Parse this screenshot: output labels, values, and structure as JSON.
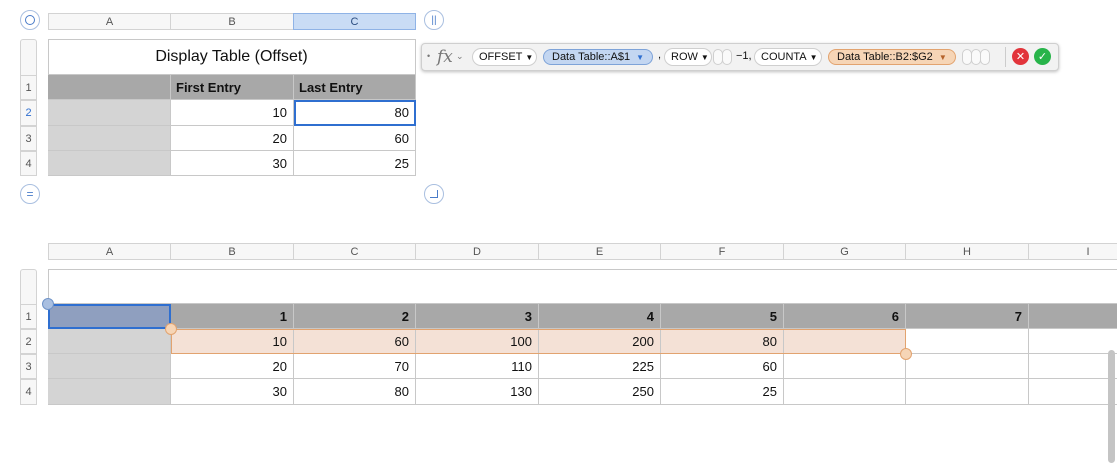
{
  "top_table": {
    "columns": [
      "A",
      "B",
      "C"
    ],
    "title": "Display Table (Offset)",
    "rows": [
      "1",
      "2",
      "3",
      "4"
    ],
    "header": [
      "",
      "First Entry",
      "Last Entry"
    ],
    "data": [
      [
        "10",
        "80"
      ],
      [
        "20",
        "60"
      ],
      [
        "30",
        "25"
      ]
    ]
  },
  "bottom_table": {
    "columns": [
      "A",
      "B",
      "C",
      "D",
      "E",
      "F",
      "G",
      "H",
      "I"
    ],
    "rows": [
      "1",
      "2",
      "3",
      "4"
    ],
    "header": [
      "1",
      "2",
      "3",
      "4",
      "5",
      "6",
      "7"
    ],
    "data": [
      [
        "10",
        "60",
        "100",
        "200",
        "80",
        "",
        ""
      ],
      [
        "20",
        "70",
        "110",
        "225",
        "60",
        "",
        ""
      ],
      [
        "30",
        "80",
        "130",
        "250",
        "25",
        "",
        ""
      ]
    ]
  },
  "formula_bar": {
    "fx": "fx",
    "fn_offset": "OFFSET",
    "ref1": "Data Table::A$1",
    "sep1": ",",
    "fn_row": "ROW",
    "minus_one": "−1,",
    "fn_counta": "COUNTA",
    "ref2": "Data Table::B2:$G2"
  },
  "colors": {
    "selection": "#2f6fd0",
    "header_gray": "#a8a8a8",
    "row_gray": "#d4d4d4",
    "range_orange": "#f4e1d6",
    "cancel": "#e2343b",
    "accept": "#28b44a"
  },
  "icons": [
    "circle-select-icon",
    "pause-icon",
    "equals-icon",
    "corner-resize-icon",
    "cancel-icon",
    "accept-icon",
    "dropdown-arrow-icon"
  ]
}
